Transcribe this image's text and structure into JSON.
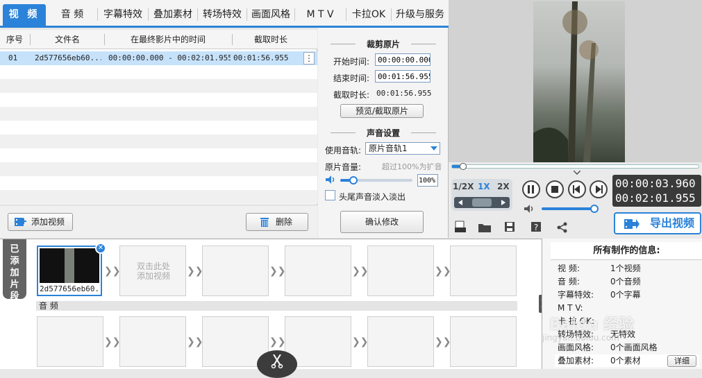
{
  "tabs": [
    {
      "label": "视 频"
    },
    {
      "label": "音 频"
    },
    {
      "label": "字幕特效"
    },
    {
      "label": "叠加素材"
    },
    {
      "label": "转场特效"
    },
    {
      "label": "画面风格"
    },
    {
      "label": "M T V"
    },
    {
      "label": "卡拉OK"
    },
    {
      "label": "升级与服务"
    }
  ],
  "table": {
    "headers": [
      "序号",
      "文件名",
      "在最终影片中的时间",
      "截取时长"
    ],
    "rows": [
      {
        "index": "01",
        "filename": "2d577656eb60...",
        "time_range": "00:00:00.000 - 00:02:01.955",
        "duration": "00:01:56.955"
      }
    ],
    "kebab": "⋮"
  },
  "left_buttons": {
    "add_video": "添加视频",
    "delete": "删除"
  },
  "clip": {
    "section_title": "裁剪原片",
    "start_label": "开始时间:",
    "start_value": "00:00:00.000",
    "end_label": "结束时间:",
    "end_value": "00:01:56.955",
    "duration_label": "截取时长:",
    "duration_value": "00:01:56.955",
    "preview_button": "预览/截取原片"
  },
  "sound": {
    "section_title": "声音设置",
    "track_label": "使用音轨:",
    "track_value": "原片音轨1",
    "volume_label": "原片音量:",
    "volume_hint": "超过100%为扩音",
    "volume_value": "100%",
    "volume_level": 0.18,
    "fade_label": "头尾声音淡入淡出",
    "confirm_button": "确认修改"
  },
  "player": {
    "speeds": [
      "1/2X",
      "1X",
      "2X"
    ],
    "time_current": "00:00:03.960",
    "time_total": "00:02:01.955",
    "progress": 0.03,
    "export_label": "导出视频",
    "accent": "#2b82d9"
  },
  "timeline": {
    "side_label": "已添加片段",
    "clip_name": "2d577656eb60...",
    "placeholder": "双击此处\n添加视频",
    "audio_label": "音 频"
  },
  "info": {
    "title": "所有制作的信息:",
    "rows": [
      {
        "key": "视    频:",
        "value": "1个视频"
      },
      {
        "key": "音    频:",
        "value": "0个音频"
      },
      {
        "key": "字幕特效:",
        "value": "0个字幕"
      },
      {
        "key": "M  T  V:",
        "value": ""
      },
      {
        "key": "卡 拉 OK:",
        "value": ""
      },
      {
        "key": "转场特效:",
        "value": "无特效"
      },
      {
        "key": "画面风格:",
        "value": "0个画面风格"
      },
      {
        "key": "叠加素材:",
        "value": "0个素材"
      }
    ],
    "detail_button": "详细"
  },
  "watermark": "Baidu 经验",
  "watermark_sub": "jingyan.baidu.com"
}
